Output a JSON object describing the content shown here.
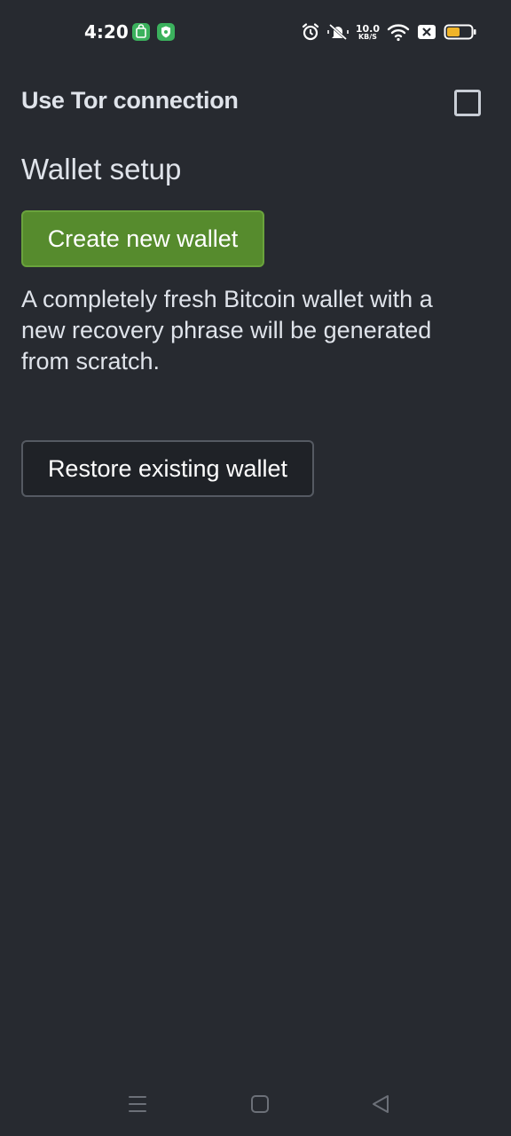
{
  "status_bar": {
    "time": "4:20",
    "net_speed_value": "10.0",
    "net_speed_unit": "KB/S",
    "battery_color": "#f0b429",
    "app_icon_color": "#3bb15d"
  },
  "settings": {
    "tor_label": "Use Tor connection",
    "tor_checked": false
  },
  "wallet_setup": {
    "title": "Wallet setup",
    "create_button": "Create new wallet",
    "create_description": "A completely fresh Bitcoin wallet with a new recovery phrase will be generated from scratch.",
    "restore_button": "Restore existing wallet"
  },
  "colors": {
    "background": "#272a30",
    "primary_green": "#568b2d",
    "text": "#dfe3ea"
  },
  "nav_bar": {
    "icons": [
      "menu-icon",
      "home-icon",
      "back-icon"
    ]
  }
}
